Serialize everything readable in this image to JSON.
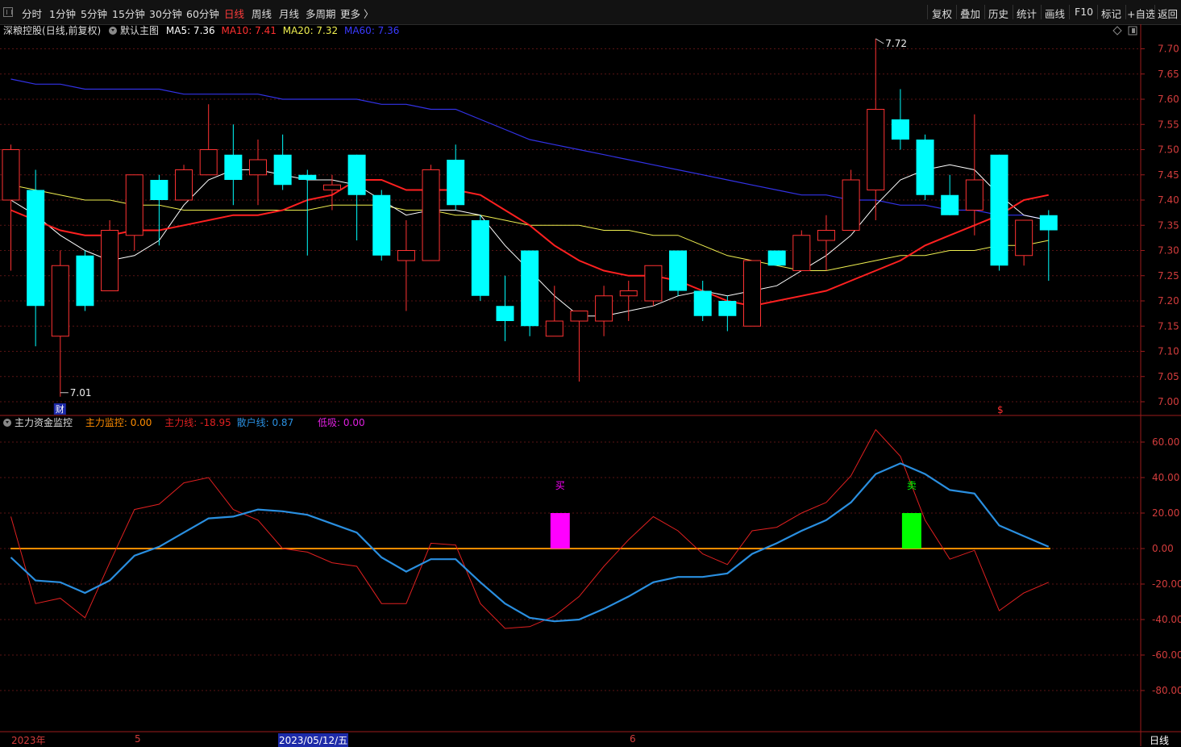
{
  "toolbar": {
    "periods": [
      "分时",
      "1分钟",
      "5分钟",
      "15分钟",
      "30分钟",
      "60分钟",
      "日线",
      "周线",
      "月线",
      "多周期",
      "更多 〉"
    ],
    "active_period": "日线",
    "right_buttons": [
      "复权",
      "叠加",
      "历史",
      "统计",
      "画线",
      "F10",
      "标记",
      "+自选",
      "返回"
    ]
  },
  "main_header": {
    "stock": "深粮控股",
    "mode": "(日线,前复权)",
    "template": "默认主图",
    "ma5": "MA5: 7.36",
    "ma10": "MA10: 7.41",
    "ma20": "MA20: 7.32",
    "ma60": "MA60: 7.36"
  },
  "indicator_header": {
    "name": "主力资金监控",
    "monitor": "主力监控: 0.00",
    "main_line": "主力线: -18.95",
    "retail_line": "散户线: 0.87",
    "low_buy": "低吸: 0.00"
  },
  "price_axis": [
    "7.70",
    "7.65",
    "7.60",
    "7.55",
    "7.50",
    "7.45",
    "7.40",
    "7.35",
    "7.30",
    "7.25",
    "7.20",
    "7.15",
    "7.10",
    "7.05",
    "7.00"
  ],
  "indicator_axis": [
    "60.00",
    "40.00",
    "20.00",
    "0.00",
    "-20.00",
    "-40.00",
    "-60.00",
    "-80.00"
  ],
  "annotations": {
    "high_label": "7.72",
    "low_label": "7.01",
    "fin_marker": "财",
    "dollar_marker": "$",
    "buy_label": "买",
    "sell_label": "卖"
  },
  "date_axis": {
    "year": "2023年",
    "month5": "5",
    "cursor_date": "2023/05/12/五",
    "month6": "6",
    "period_badge": "日线"
  },
  "colors": {
    "up": "#ff3232",
    "down": "#00ffff",
    "ma5": "#ffffff",
    "ma10": "#ff2020",
    "ma20": "#f0f050",
    "ma60": "#3232e6",
    "main_line": "#e02020",
    "retail_line": "#2a8fe0",
    "zero_line": "#ff8c00",
    "buy_bar": "#ff00ff",
    "sell_bar": "#00ff00"
  },
  "chart_data": {
    "type": "candlestick",
    "ylim": [
      7.0,
      7.7
    ],
    "candles": [
      {
        "o": 7.4,
        "c": 7.5,
        "h": 7.51,
        "l": 7.26
      },
      {
        "o": 7.42,
        "c": 7.19,
        "h": 7.46,
        "l": 7.11
      },
      {
        "o": 7.13,
        "c": 7.27,
        "h": 7.3,
        "l": 7.01
      },
      {
        "o": 7.29,
        "c": 7.19,
        "h": 7.3,
        "l": 7.18
      },
      {
        "o": 7.22,
        "c": 7.34,
        "h": 7.36,
        "l": 7.22
      },
      {
        "o": 7.33,
        "c": 7.45,
        "h": 7.45,
        "l": 7.3
      },
      {
        "o": 7.44,
        "c": 7.4,
        "h": 7.45,
        "l": 7.31
      },
      {
        "o": 7.4,
        "c": 7.46,
        "h": 7.47,
        "l": 7.4
      },
      {
        "o": 7.45,
        "c": 7.5,
        "h": 7.59,
        "l": 7.45
      },
      {
        "o": 7.49,
        "c": 7.44,
        "h": 7.55,
        "l": 7.39
      },
      {
        "o": 7.45,
        "c": 7.48,
        "h": 7.52,
        "l": 7.39
      },
      {
        "o": 7.49,
        "c": 7.43,
        "h": 7.53,
        "l": 7.42
      },
      {
        "o": 7.45,
        "c": 7.44,
        "h": 7.46,
        "l": 7.29
      },
      {
        "o": 7.42,
        "c": 7.43,
        "h": 7.45,
        "l": 7.38
      },
      {
        "o": 7.49,
        "c": 7.41,
        "h": 7.49,
        "l": 7.32
      },
      {
        "o": 7.41,
        "c": 7.29,
        "h": 7.42,
        "l": 7.28
      },
      {
        "o": 7.28,
        "c": 7.3,
        "h": 7.36,
        "l": 7.18
      },
      {
        "o": 7.28,
        "c": 7.46,
        "h": 7.47,
        "l": 7.28
      },
      {
        "o": 7.48,
        "c": 7.39,
        "h": 7.51,
        "l": 7.38
      },
      {
        "o": 7.36,
        "c": 7.21,
        "h": 7.37,
        "l": 7.2
      },
      {
        "o": 7.19,
        "c": 7.16,
        "h": 7.25,
        "l": 7.12
      },
      {
        "o": 7.3,
        "c": 7.15,
        "h": 7.3,
        "l": 7.13
      },
      {
        "o": 7.13,
        "c": 7.16,
        "h": 7.23,
        "l": 7.13
      },
      {
        "o": 7.16,
        "c": 7.18,
        "h": 7.18,
        "l": 7.04
      },
      {
        "o": 7.16,
        "c": 7.21,
        "h": 7.23,
        "l": 7.13
      },
      {
        "o": 7.21,
        "c": 7.22,
        "h": 7.24,
        "l": 7.16
      },
      {
        "o": 7.2,
        "c": 7.27,
        "h": 7.27,
        "l": 7.19
      },
      {
        "o": 7.3,
        "c": 7.22,
        "h": 7.3,
        "l": 7.21
      },
      {
        "o": 7.22,
        "c": 7.17,
        "h": 7.24,
        "l": 7.16
      },
      {
        "o": 7.2,
        "c": 7.17,
        "h": 7.21,
        "l": 7.14
      },
      {
        "o": 7.15,
        "c": 7.28,
        "h": 7.28,
        "l": 7.15
      },
      {
        "o": 7.3,
        "c": 7.27,
        "h": 7.3,
        "l": 7.27
      },
      {
        "o": 7.26,
        "c": 7.33,
        "h": 7.34,
        "l": 7.26
      },
      {
        "o": 7.32,
        "c": 7.34,
        "h": 7.37,
        "l": 7.26
      },
      {
        "o": 7.34,
        "c": 7.44,
        "h": 7.46,
        "l": 7.35
      },
      {
        "o": 7.42,
        "c": 7.58,
        "h": 7.72,
        "l": 7.36
      },
      {
        "o": 7.56,
        "c": 7.52,
        "h": 7.62,
        "l": 7.5
      },
      {
        "o": 7.52,
        "c": 7.41,
        "h": 7.53,
        "l": 7.4
      },
      {
        "o": 7.41,
        "c": 7.37,
        "h": 7.45,
        "l": 7.37
      },
      {
        "o": 7.38,
        "c": 7.44,
        "h": 7.57,
        "l": 7.33
      },
      {
        "o": 7.49,
        "c": 7.27,
        "h": 7.49,
        "l": 7.26
      },
      {
        "o": 7.29,
        "c": 7.36,
        "h": 7.36,
        "l": 7.27
      },
      {
        "o": 7.37,
        "c": 7.34,
        "h": 7.38,
        "l": 7.24
      }
    ],
    "ma5": [
      7.4,
      7.37,
      7.33,
      7.3,
      7.28,
      7.29,
      7.32,
      7.39,
      7.44,
      7.46,
      7.46,
      7.45,
      7.44,
      7.44,
      7.43,
      7.4,
      7.37,
      7.38,
      7.38,
      7.37,
      7.31,
      7.26,
      7.21,
      7.17,
      7.17,
      7.18,
      7.19,
      7.21,
      7.22,
      7.21,
      7.22,
      7.23,
      7.26,
      7.29,
      7.33,
      7.39,
      7.44,
      7.46,
      7.47,
      7.46,
      7.41,
      7.37,
      7.36
    ],
    "ma10": [
      7.38,
      7.36,
      7.34,
      7.33,
      7.33,
      7.34,
      7.34,
      7.35,
      7.36,
      7.37,
      7.37,
      7.38,
      7.4,
      7.41,
      7.44,
      7.44,
      7.42,
      7.42,
      7.42,
      7.41,
      7.38,
      7.35,
      7.31,
      7.28,
      7.26,
      7.25,
      7.25,
      7.24,
      7.22,
      7.2,
      7.19,
      7.2,
      7.21,
      7.22,
      7.24,
      7.26,
      7.28,
      7.31,
      7.33,
      7.35,
      7.37,
      7.4,
      7.41
    ],
    "ma20": [
      7.43,
      7.42,
      7.41,
      7.4,
      7.4,
      7.39,
      7.39,
      7.38,
      7.38,
      7.38,
      7.38,
      7.38,
      7.38,
      7.39,
      7.39,
      7.39,
      7.38,
      7.38,
      7.37,
      7.37,
      7.36,
      7.35,
      7.35,
      7.35,
      7.34,
      7.34,
      7.33,
      7.33,
      7.31,
      7.29,
      7.28,
      7.27,
      7.26,
      7.26,
      7.27,
      7.28,
      7.29,
      7.29,
      7.3,
      7.3,
      7.31,
      7.31,
      7.32
    ],
    "ma60": [
      7.64,
      7.63,
      7.63,
      7.62,
      7.62,
      7.62,
      7.62,
      7.61,
      7.61,
      7.61,
      7.61,
      7.6,
      7.6,
      7.6,
      7.6,
      7.59,
      7.59,
      7.58,
      7.58,
      7.56,
      7.54,
      7.52,
      7.51,
      7.5,
      7.49,
      7.48,
      7.47,
      7.46,
      7.45,
      7.44,
      7.43,
      7.42,
      7.41,
      7.41,
      7.4,
      7.4,
      7.39,
      7.39,
      7.38,
      7.38,
      7.37,
      7.37,
      7.36
    ],
    "indicator_ylim": [
      -90,
      70
    ],
    "main_line": [
      18,
      -31,
      -28,
      -39,
      -8,
      22,
      25,
      37,
      40,
      22,
      16,
      0,
      -2,
      -8,
      -10,
      -31,
      -31,
      3,
      2,
      -31,
      -45,
      -44,
      -38,
      -27,
      -10,
      5,
      18,
      10,
      -3,
      -9,
      10,
      12,
      20,
      26,
      41,
      67,
      52,
      16,
      -6,
      -1,
      -35,
      -25,
      -19
    ],
    "retail_line": [
      -5,
      -18,
      -19,
      -25,
      -18,
      -4,
      1,
      9,
      17,
      18,
      22,
      21,
      19,
      14,
      9,
      -5,
      -13,
      -6,
      -6,
      -19,
      -31,
      -39,
      -41,
      -40,
      -34,
      -27,
      -19,
      -16,
      -16,
      -14,
      -3,
      3,
      10,
      16,
      26,
      42,
      48,
      42,
      33,
      31,
      13,
      7,
      1
    ],
    "buy_signal": {
      "index": 22,
      "value": 20
    },
    "sell_signal": {
      "index": 36,
      "value": 20
    }
  }
}
